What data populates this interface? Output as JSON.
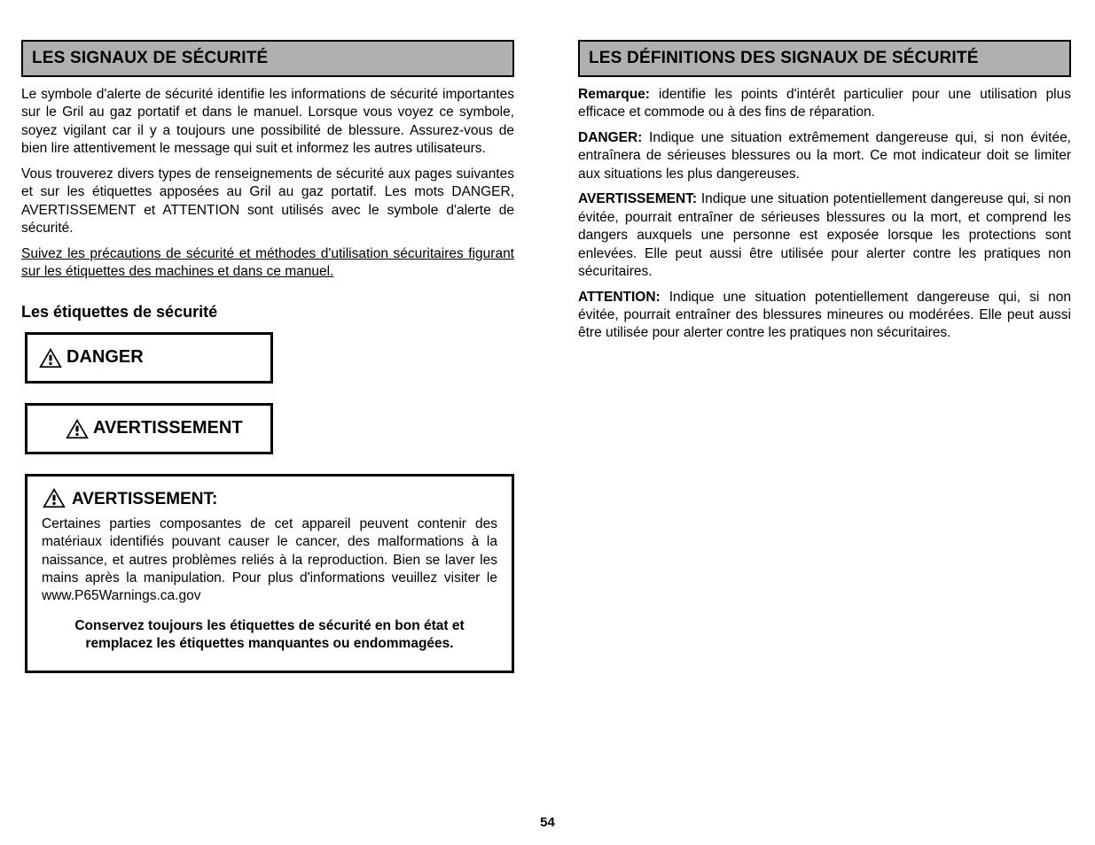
{
  "left": {
    "header": "LES SIGNAUX DE SÉCURITÉ",
    "paragraphs": [
      "Le symbole d'alerte de sécurité identifie les informations de sécurité importantes sur le Gril au gaz portatif et dans le manuel. Lorsque vous voyez ce symbole, soyez vigilant car il y a toujours une possibilité de blessure. Assurez-vous de bien lire attentivement le message qui suit et informez les autres utilisateurs.",
      "Vous trouverez divers types de renseignements de sécurité aux pages suivantes et sur les étiquettes apposées au Gril au gaz portatif. Les mots DANGER, AVERTISSEMENT et ATTENTION sont utilisés avec le symbole d'alerte de sécurité.",
      "Suivez les précautions de sécurité et méthodes d'utilisation sécuritaires figurant sur les étiquettes des machines et dans ce manuel."
    ],
    "labels_heading": "Les étiquettes de sécurité",
    "danger_label": "DANGER",
    "avert_label": "AVERTISSEMENT",
    "warning_word": "AVERTISSEMENT:",
    "warning_body": "Certaines parties composantes de cet appareil peuvent contenir des matériaux identifiés pouvant causer le cancer, des malformations à la naissance, et autres problèmes reliés à la reproduction. Bien se laver les mains après la manipulation. Pour plus d'informations veuillez visiter le www.P65Warnings.ca.gov",
    "warning_final": "Conservez toujours les étiquettes de sécurité en bon état et remplacez les étiquettes manquantes ou endommagées."
  },
  "right": {
    "header": "LES DÉFINITIONS DES SIGNAUX DE SÉCURITÉ",
    "note_label": "Remarque:",
    "note_text": "identifie les points d'intérêt particulier pour une utilisation plus efficace et commode ou à des fins de réparation.",
    "danger_label": "DANGER:",
    "danger_text": "Indique une situation extrêmement dangereuse qui, si non évitée, entraînera de sérieuses blessures ou la mort. Ce mot indicateur doit se limiter aux situations les plus dangereuses.",
    "avert_label": "AVERTISSEMENT:",
    "avert_text": "Indique une situation potentiellement dangereuse qui, si non évitée, pourrait entraîner de sérieuses blessures ou la mort, et comprend les dangers auxquels une personne est exposée lorsque les protections sont enlevées. Elle peut aussi être utilisée pour alerter contre les pratiques non sécuritaires.",
    "attn_label": "ATTENTION:",
    "attn_text": "Indique une situation potentiellement dangereuse qui, si non évitée, pourrait entraîner des blessures mineures ou modérées. Elle peut aussi être utilisée pour alerter contre les pratiques non sécuritaires."
  },
  "page_number": "54"
}
